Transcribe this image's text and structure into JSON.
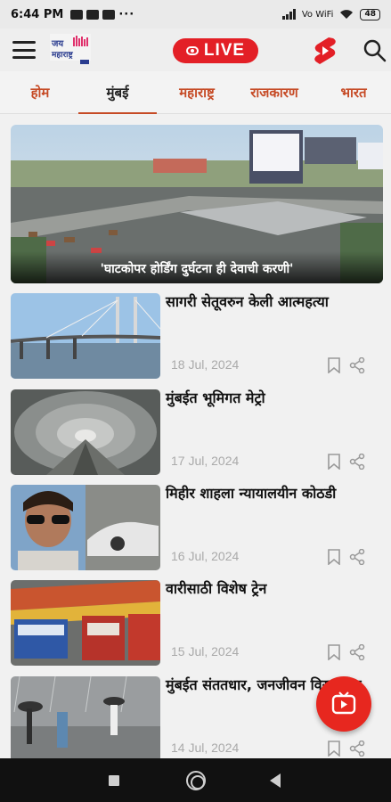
{
  "status": {
    "time": "6:44 PM",
    "net": "Vo WiFi",
    "battery": "48"
  },
  "header": {
    "live_label": "LIVE",
    "colors": {
      "live": "#e31f26",
      "tab_text": "#c64a25"
    }
  },
  "tabs": [
    {
      "label": "होम"
    },
    {
      "label": "मुंबई",
      "active": true
    },
    {
      "label": "महाराष्ट्र"
    },
    {
      "label": "राजकारण"
    },
    {
      "label": "भारत"
    }
  ],
  "hero": {
    "caption": "'घाटकोपर होर्डिंग दुर्घटना ही देवाची करणी'"
  },
  "articles": [
    {
      "title": "सागरी सेतूवरुन केली आत्महत्या",
      "date": "18 Jul, 2024"
    },
    {
      "title": "मुंबईत भूमिगत मेट्रो",
      "date": "17 Jul, 2024"
    },
    {
      "title": "मिहीर शाहला न्यायालयीन कोठडी",
      "date": "16 Jul, 2024"
    },
    {
      "title": "वारीसाठी विशेष ट्रेन",
      "date": "15 Jul, 2024"
    },
    {
      "title": "मुंबईत संततधार, जनजीवन विस्कळीत",
      "date": "14 Jul, 2024"
    }
  ]
}
